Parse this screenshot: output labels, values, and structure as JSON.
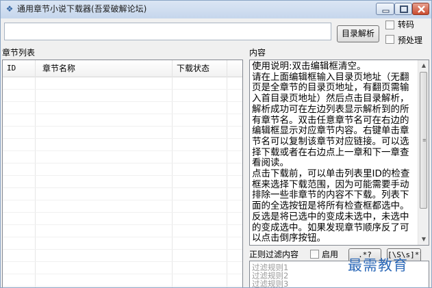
{
  "window": {
    "title": "通用章节小说下载器(吾爱破解论坛)",
    "app_icon": "book-icon",
    "controls": [
      "minimize-icon",
      "maximize-icon",
      "close-icon"
    ]
  },
  "toolbar": {
    "url_value": "",
    "parse_button": "目录解析",
    "transcode_label": "转码",
    "transcode_checked": false,
    "preprocess_label": "预处理",
    "preprocess_checked": false
  },
  "chapter_list": {
    "title": "章节列表",
    "columns": [
      "ID",
      "章节名称",
      "下载状态"
    ],
    "rows": []
  },
  "content": {
    "title": "内容",
    "text": "使用说明:双击编辑框清空。\n请在上面编辑框输入目录页地址（无翻页是全章节的目录页地址，有翻页需输入首目录页地址）然后点击目录解析，解析成功可在左边列表显示解析到的所有章节名。双击任意章节名可在右边的编辑框显示对应章节内容。右键单击章节名可以复制该章节对应链接。可以选择下载或者在右边点上一章和下一章查看阅读。\n点击下载前，可以单击列表里ID的检查框来选择下载范围，因为可能需要手动排除一些非章节的内容不下载。列表下面的全选按钮是将所有检查框都选中。反选是将已选中的变成未选中，未选中的变成选中。如果发现章节顺序反了可以点击倒序按钮。"
  },
  "filter": {
    "label": "正则过滤内容",
    "enable_label": "启用",
    "enable_checked": false,
    "wildcard_button": ".*?",
    "regex_button": "[\\S\\s]*?",
    "rules": [
      "过滤规则1",
      "过滤规则2",
      "过滤规则3"
    ]
  },
  "watermark": "最需教育",
  "colors": {
    "titlebar": "#c5d6ec",
    "window_bg": "#f0f0f0",
    "close_button": "#c94b2e",
    "watermark": "#2e6ab8"
  }
}
